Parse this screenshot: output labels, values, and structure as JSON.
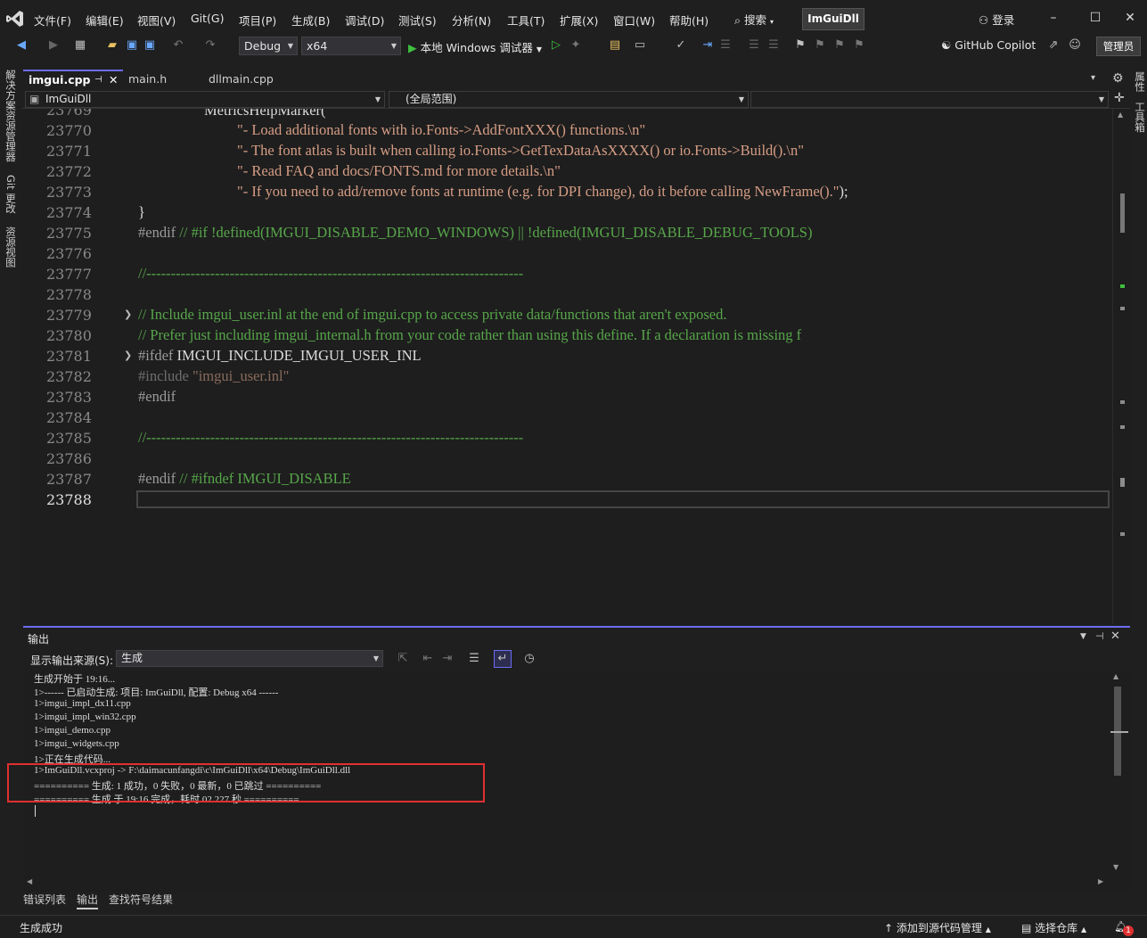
{
  "menubar": {
    "items": [
      "文件(F)",
      "编辑(E)",
      "视图(V)",
      "Git(G)",
      "项目(P)",
      "生成(B)",
      "调试(D)",
      "测试(S)",
      "分析(N)",
      "工具(T)",
      "扩展(X)",
      "窗口(W)",
      "帮助(H)"
    ],
    "search_label": "搜索",
    "solution_name": "ImGuiDll",
    "login_label": "登录"
  },
  "toolbar": {
    "config": "Debug",
    "platform": "x64",
    "run_label": "本地 Windows 调试器",
    "copilot_label": "GitHub Copilot",
    "admin_label": "管理员"
  },
  "left_tabs": [
    "解决方案资源管理器",
    "Git 更改",
    "资源视图"
  ],
  "right_tabs": [
    "属性",
    "工具箱"
  ],
  "doc_tabs": [
    {
      "label": "imgui.cpp",
      "active": true
    },
    {
      "label": "main.h",
      "active": false
    },
    {
      "label": "dllmain.cpp",
      "active": false
    }
  ],
  "navbar": {
    "project": "ImGuiDll",
    "scope": "(全局范围)"
  },
  "editor": {
    "first_partial_line": "23769",
    "line_numbers": [
      "23770",
      "23771",
      "23772",
      "23773",
      "23774",
      "23775",
      "23776",
      "23777",
      "23778",
      "23779",
      "23780",
      "23781",
      "23782",
      "23783",
      "23784",
      "23785",
      "23786",
      "23787",
      "23788"
    ],
    "partial_code": "MetricsHelpMarker(",
    "lines": {
      "l23770_str": "\"- Load additional fonts with io.Fonts->AddFontXXX() functions.\\n\"",
      "l23771_str": "\"- The font atlas is built when calling io.Fonts->GetTexDataAsXXXX() or io.Fonts->Build().\\n\"",
      "l23772_str": "\"- Read FAQ and docs/FONTS.md for more details.\\n\"",
      "l23773_str": "\"- If you need to add/remove fonts at runtime (e.g. for DPI change), do it before calling NewFrame().\"",
      "l23773_end": ");",
      "l23774": "}",
      "l23775_pp": "#endif",
      "l23775_com": "// #if !defined(IMGUI_DISABLE_DEMO_WINDOWS) || !defined(IMGUI_DISABLE_DEBUG_TOOLS)",
      "l23777_com": "//-----------------------------------------------------------------------------",
      "l23779_com": "// Include imgui_user.inl at the end of imgui.cpp to access private data/functions that aren't exposed.",
      "l23780_com": "// Prefer just including imgui_internal.h from your code rather than using this define. If a declaration is missing f",
      "l23781_pp": "#ifdef",
      "l23781_def": "IMGUI_INCLUDE_IMGUI_USER_INL",
      "l23782_pp": "#include",
      "l23782_str": "\"imgui_user.inl\"",
      "l23783_pp": "#endif",
      "l23785_com": "//-----------------------------------------------------------------------------",
      "l23787_pp": "#endif",
      "l23787_com": "// #ifndef IMGUI_DISABLE"
    }
  },
  "output": {
    "title": "输出",
    "source_label": "显示输出来源(S):",
    "source_value": "生成",
    "lines": [
      "生成开始于 19:16...",
      "1>------ 已启动生成: 项目: ImGuiDll, 配置: Debug x64 ------",
      "1>imgui_impl_dx11.cpp",
      "1>imgui_impl_win32.cpp",
      "1>imgui_demo.cpp",
      "1>imgui_widgets.cpp",
      "1>正在生成代码...",
      "1>ImGuiDll.vcxproj -> F:\\daimacunfangdi\\c\\ImGuiDll\\x64\\Debug\\ImGuiDll.dll",
      "========== 生成: 1 成功，0 失败，0 最新，0 已跳过 ==========",
      "========== 生成 于 19:16 完成，耗时 02.227 秒 =========="
    ]
  },
  "bottom_tabs": [
    "错误列表",
    "输出",
    "查找符号结果"
  ],
  "statusbar": {
    "status": "生成成功",
    "add_source": "添加到源代码管理",
    "select_repo": "选择仓库",
    "notifications": "1"
  },
  "colors": {
    "accent": "#6c6cf0",
    "highlight_box": "#e03030",
    "run_green": "#3fbf3f"
  }
}
